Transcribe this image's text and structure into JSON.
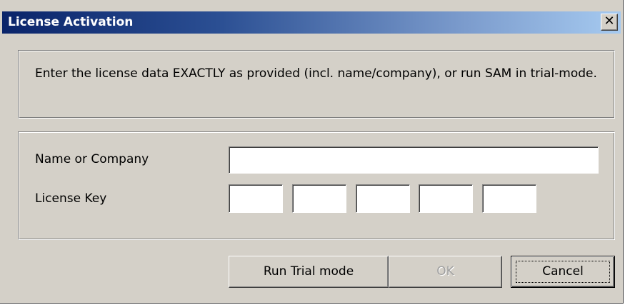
{
  "window": {
    "title": "License Activation",
    "close_glyph": "✕"
  },
  "instructions": {
    "text": "Enter the license data EXACTLY as provided (incl. name/company), or run SAM in trial-mode."
  },
  "form": {
    "name_label": "Name or Company",
    "name_value": "",
    "key_label": "License Key",
    "key_values": [
      "",
      "",
      "",
      "",
      ""
    ]
  },
  "buttons": {
    "trial_label": "Run Trial mode",
    "ok_label": "OK",
    "cancel_label": "Cancel"
  },
  "colors": {
    "titlebar_start": "#0a246a",
    "titlebar_end": "#a6caf0",
    "dialog_face": "#d4d0c8"
  }
}
